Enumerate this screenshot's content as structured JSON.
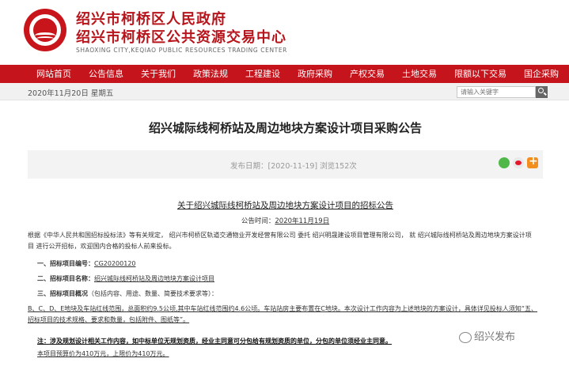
{
  "header": {
    "title_line1": "绍兴市柯桥区人民政府",
    "title_line2": "绍兴市柯桥区公共资源交易中心",
    "subtitle_en": "SHAOXING CITY,KEQIAO PUBLIC RESOURCES TRADING CENTER",
    "logo_icon": "government-emblem-icon"
  },
  "nav": {
    "items": [
      "网站首页",
      "公告信息",
      "关于我们",
      "政策法规",
      "工程建设",
      "政府采购",
      "产权交易",
      "土地交易",
      "限额以下交易",
      "国企采购"
    ]
  },
  "datebar": {
    "date": "2020年11月20日 星期五",
    "search_placeholder": "请输入关键字"
  },
  "article": {
    "title": "绍兴城际线柯桥站及周边地块方案设计项目采购公告",
    "meta": "发布日期：[2020-11-19]   浏览152次",
    "doc_title": "关于绍兴城际线柯桥站及周边地块方案设计项目的招标公告",
    "doc_date_label": "公告时间：",
    "doc_date_value": "2020年11月19日",
    "para1": "根据《中华人民共和国招标投标法》等有关规定，   绍兴市柯桥区轨道交通物业开发经营有限公司 委托  绍兴明晟建设项目管理有限公司， 就  绍兴城际线柯桥站及周边地块方案设计项",
    "para2": "目 进行公开招标，欢迎国内合格的投标人前来投标。",
    "item1_label": "一、招标项目编号：",
    "item1_value": "CG20200120",
    "item2_label": "二、招标项目名称：",
    "item2_value": "绍兴城际线柯桥站及周边地块方案设计项目",
    "item3_label": "三、招标项目概况",
    "item3_note": "（包括内容、用途、数量、简要技术要求等）：",
    "para6": "B、C、D、E地块及车站红线范围，总面积约9.5公顷,其中车站红线范围约4.6公顷。车站站房主要布置在C地块。本次设计工作内容为上述地块的方案设计，具体详见投标人须知“五、",
    "para7": "招标项目的技术规格、要求和数量，包括附件、图纸等”。",
    "para8": "注：涉及规划设计相关工作内容，如中标单位无规划资质，经业主同意可分包给有规划资质的单位，分包的单位须经业主同意。",
    "para9": "本项目预算价为410万元，上限价为410万元。"
  },
  "share": {
    "icons": [
      "wechat-icon",
      "weibo-icon",
      "more-icon"
    ]
  },
  "watermark": {
    "text": "绍兴发布"
  },
  "colors": {
    "brand_red": "#c6141d",
    "title_red": "#b8141b"
  }
}
